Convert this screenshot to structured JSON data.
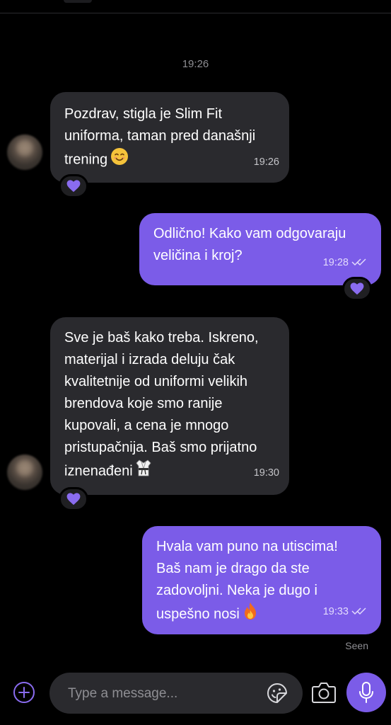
{
  "header": {
    "time": "19:26"
  },
  "messages": [
    {
      "direction": "incoming",
      "text": "Pozdrav, stigla je Slim Fit\nuniforma, taman pred današnji\ntrening",
      "emoji": "smiling-face-icon",
      "time": "19:26",
      "reaction": "heart-icon"
    },
    {
      "direction": "outgoing",
      "text": "Odlično! Kako vam odgovaraju\nveličina i kroj?",
      "time": "19:28",
      "status": "read-ticks-icon",
      "reaction": "heart-icon"
    },
    {
      "direction": "incoming",
      "text": "Sve je baš kako treba. Iskreno,\nmaterijal i izrada deluju čak\nkvalitetnije od uniformi velikih\nbrendova koje smo ranije\nkupovali, a cena je mnogo\npristupačnija. Baš smo prijatno\niznenađeni",
      "emoji": "karate-uniform-icon",
      "time": "19:30",
      "reaction": "heart-icon"
    },
    {
      "direction": "outgoing",
      "text": "Hvala vam puno na utiscima!\nBaš nam je drago da ste\nzadovoljni. Neka je dugo i\nuspešno nosi",
      "emoji": "fire-icon",
      "time": "19:33",
      "status": "read-ticks-icon"
    }
  ],
  "seen_label": "Seen",
  "composer": {
    "placeholder": "Type a message...",
    "value": ""
  },
  "colors": {
    "background": "#000000",
    "incoming_bubble": "#2a2a2e",
    "outgoing_bubble": "#7b5ce8",
    "accent": "#7b5ce8"
  }
}
